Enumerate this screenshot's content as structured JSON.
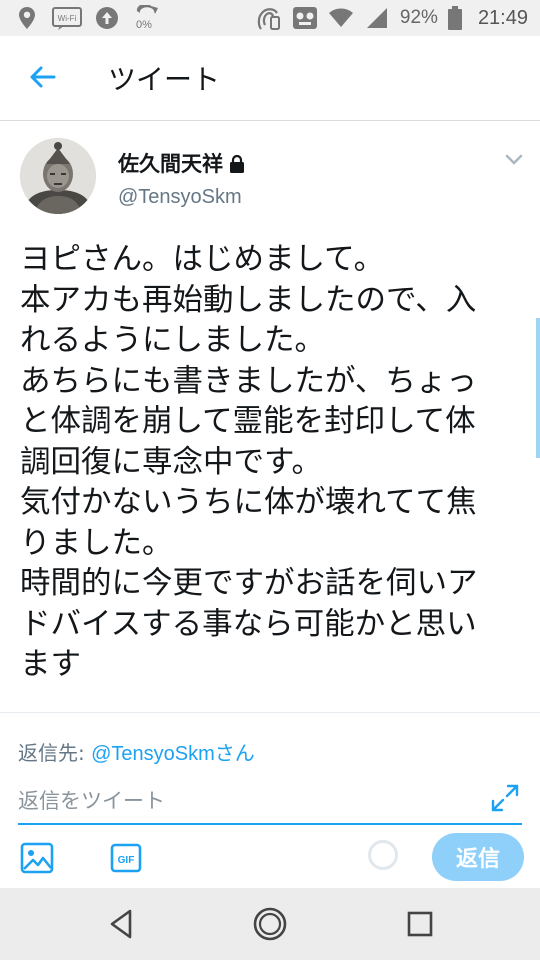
{
  "status_bar": {
    "wifi_badge": "Wi-Fi",
    "data_percent": "0%",
    "battery": "92%",
    "time": "21:49",
    "icons": [
      "location-icon",
      "wifi-calling-icon",
      "upload-icon",
      "data-saver-icon",
      "nfc-icon",
      "voicemail-icon",
      "wifi-icon",
      "signal-icon",
      "battery-icon"
    ]
  },
  "header": {
    "title": "ツイート",
    "back_icon": "back-arrow-icon"
  },
  "tweet": {
    "user_name": "佐久間天祥",
    "handle": "@TensyoSkm",
    "protected_icon": "lock-icon",
    "menu_icon": "chevron-down-icon",
    "lines": [
      "ヨピさん。はじめまして。",
      "本アカも再始動しましたので、入",
      "れるようにしました。",
      "あちらにも書きましたが、ちょっ",
      "と体調を崩して霊能を封印して体",
      "調回復に専念中です。",
      "気付かないうちに体が壊れてて焦",
      "りました。",
      "時間的に今更ですがお話を伺いア",
      "ドバイスする事なら可能かと思い",
      "ます"
    ]
  },
  "reply": {
    "reply_to_label": "返信先: ",
    "reply_to_handle": "@TensyoSkm",
    "reply_to_suffix": "さん",
    "placeholder": "返信をツイート",
    "gif_label": "GIF",
    "button_label": "返信",
    "accent_color": "#1da1f2",
    "button_color": "#8ed0f9"
  },
  "nav": {
    "icons": [
      "nav-back-icon",
      "nav-home-icon",
      "nav-recents-icon"
    ]
  }
}
